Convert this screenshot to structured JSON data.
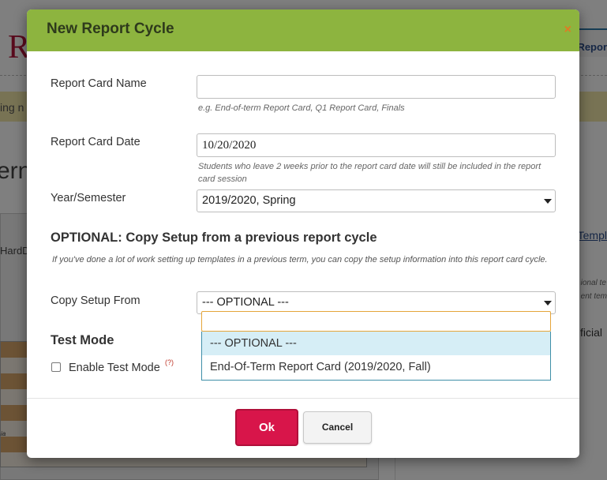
{
  "background": {
    "logo": "R",
    "banner_text": "ing n",
    "big_text": "ern",
    "tab_text": "Repor",
    "left_text": "HardD",
    "right_link": "Templ",
    "right_small_1": "ional te",
    "right_small_2": "ent tem",
    "right_label": "ficial",
    "grid_text": "ia"
  },
  "modal": {
    "title": "New Report Cycle",
    "close_icon": "×",
    "report_card_name": {
      "label": "Report Card Name",
      "value": "",
      "hint": "e.g. End-of-term Report Card, Q1 Report Card, Finals"
    },
    "report_card_date": {
      "label": "Report Card Date",
      "value": "10/20/2020",
      "hint": "Students who leave 2 weeks prior to the report card date will still be included in the report card session"
    },
    "year_semester": {
      "label": "Year/Semester",
      "value": "2019/2020, Spring"
    },
    "optional_section": {
      "title": "OPTIONAL: Copy Setup from a previous report cycle",
      "description": "If you've done a lot of work setting up templates in a previous term, you can copy the setup information into this report card cycle."
    },
    "copy_setup_from": {
      "label": "Copy Setup From",
      "value": "--- OPTIONAL ---",
      "search_value": "",
      "options": [
        "--- OPTIONAL ---",
        "End-Of-Term Report Card (2019/2020, Fall)"
      ],
      "highlighted_index": 0
    },
    "test_mode": {
      "title": "Test Mode",
      "checkbox_label": "Enable Test Mode",
      "checked": false,
      "help_mark": "(?)"
    },
    "buttons": {
      "ok": "Ok",
      "cancel": "Cancel"
    }
  },
  "colors": {
    "header": "#8db43f",
    "ok_button": "#d8154a",
    "close_icon": "#e07b24",
    "dropdown_highlight": "#d6eef6"
  }
}
